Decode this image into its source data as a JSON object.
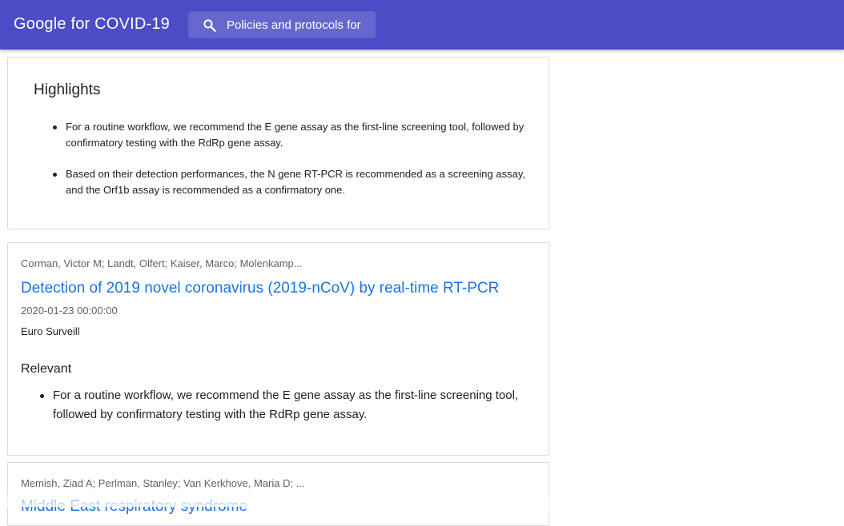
{
  "header": {
    "app_title": "Google for COVID-19",
    "search": {
      "value": "Policies and protocols for",
      "icon": "search-icon"
    },
    "colors": {
      "bar": "#4c4cc6",
      "search_bg": "#6666cf"
    }
  },
  "highlights": {
    "title": "Highlights",
    "items": [
      "For a routine workflow, we recommend the E gene assay as the first-line screening tool, followed by confirmatory testing with the RdRp gene assay.",
      "Based on their detection performances, the N gene RT-PCR is recommended as a screening assay, and the Orf1b assay is recommended as a confirmatory one."
    ]
  },
  "results": [
    {
      "authors": "Corman, Victor M; Landt, Olfert; Kaiser, Marco; Molenkamp...",
      "title": "Detection of 2019 novel coronavirus (2019-nCoV) by real-time RT-PCR",
      "date": "2020-01-23 00:00:00",
      "journal": "Euro Surveill",
      "relevant_label": "Relevant",
      "relevant_items": [
        "For a routine workflow, we recommend the E gene assay as the first-line screening tool, followed by confirmatory testing with the RdRp gene assay."
      ]
    },
    {
      "authors": "Memish, Ziad A; Perlman, Stanley; Van Kerkhove, Maria D; ...",
      "title": "Middle East respiratory syndrome"
    }
  ],
  "colors": {
    "link": "#1a73e8",
    "meta": "#5f6368",
    "text": "#202124"
  }
}
